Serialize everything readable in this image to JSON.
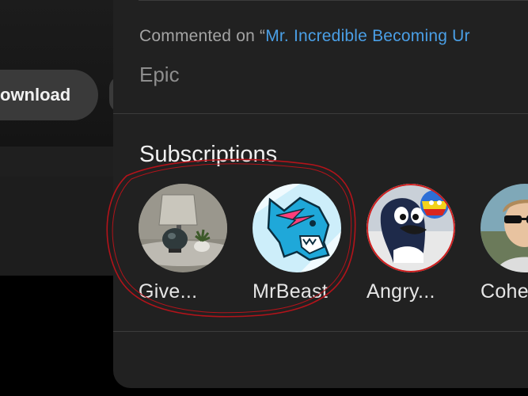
{
  "background": {
    "download_label": "ownload"
  },
  "activity": {
    "commented_prefix": "Commented on “",
    "commented_video": "Mr. Incredible Becoming Ur",
    "comment_text": "Epic"
  },
  "subscriptions": {
    "title": "Subscriptions",
    "items": [
      {
        "name": "Give..."
      },
      {
        "name": "MrBeast"
      },
      {
        "name": "Angry..."
      },
      {
        "name": "Cohe"
      }
    ]
  },
  "colors": {
    "link": "#4a9fe6",
    "annotation": "#b3131a"
  }
}
